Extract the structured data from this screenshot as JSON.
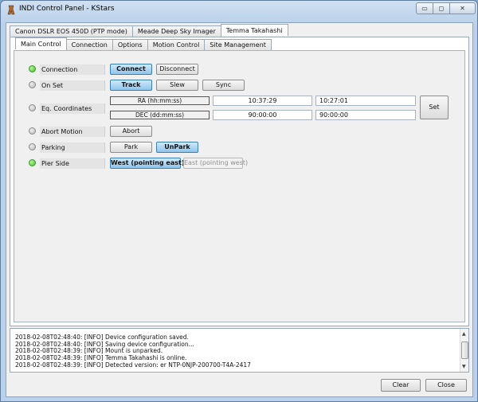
{
  "window": {
    "title": "INDI Control Panel - KStars",
    "controls": {
      "minimize": "▭",
      "maximize": "◻",
      "close": "✕"
    }
  },
  "device_tabs": [
    "Canon DSLR EOS 450D (PTP mode)",
    "Meade Deep Sky Imager",
    "Temma Takahashi"
  ],
  "active_device": "Temma Takahashi",
  "sub_tabs": [
    "Main Control",
    "Connection",
    "Options",
    "Motion Control",
    "Site Management"
  ],
  "active_sub_tab": "Main Control",
  "properties": {
    "connection": {
      "label": "Connection",
      "state": "ok",
      "connect": "Connect",
      "disconnect": "Disconnect",
      "selected": "Connect"
    },
    "on_set": {
      "label": "On Set",
      "state": "idle",
      "track": "Track",
      "slew": "Slew",
      "sync": "Sync",
      "selected": "Track"
    },
    "eq_coords": {
      "label": "Eq. Coordinates",
      "state": "idle",
      "ra_label": "RA (hh:mm:ss)",
      "ra_value": "10:37:29",
      "ra_input": "10:27:01",
      "dec_label": "DEC (dd:mm:ss)",
      "dec_value": "90:00:00",
      "dec_input": "90:00:00",
      "set": "Set"
    },
    "abort": {
      "label": "Abort Motion",
      "state": "idle",
      "abort": "Abort"
    },
    "parking": {
      "label": "Parking",
      "state": "idle",
      "park": "Park",
      "unpark": "UnPark",
      "selected": "UnPark"
    },
    "pier_side": {
      "label": "Pier Side",
      "state": "ok",
      "west": "West (pointing east)",
      "east": "East (pointing west)",
      "selected": "West (pointing east)"
    }
  },
  "log": [
    "2018-02-08T02:48:40: [INFO] Device configuration saved.",
    "2018-02-08T02:48:40: [INFO] Saving device configuration...",
    "2018-02-08T02:48:39: [INFO] Mount is unparked.",
    "2018-02-08T02:48:39: [INFO] Temma Takahashi is online.",
    "2018-02-08T02:48:39: [INFO] Detected version: er NTP-0NJP-200700-T4A-2417"
  ],
  "buttons": {
    "clear": "Clear",
    "close": "Close"
  },
  "colors": {
    "light_ok": "#3fbf26",
    "light_idle": "#b9b9b9",
    "button_on": "#8fc4ec"
  }
}
